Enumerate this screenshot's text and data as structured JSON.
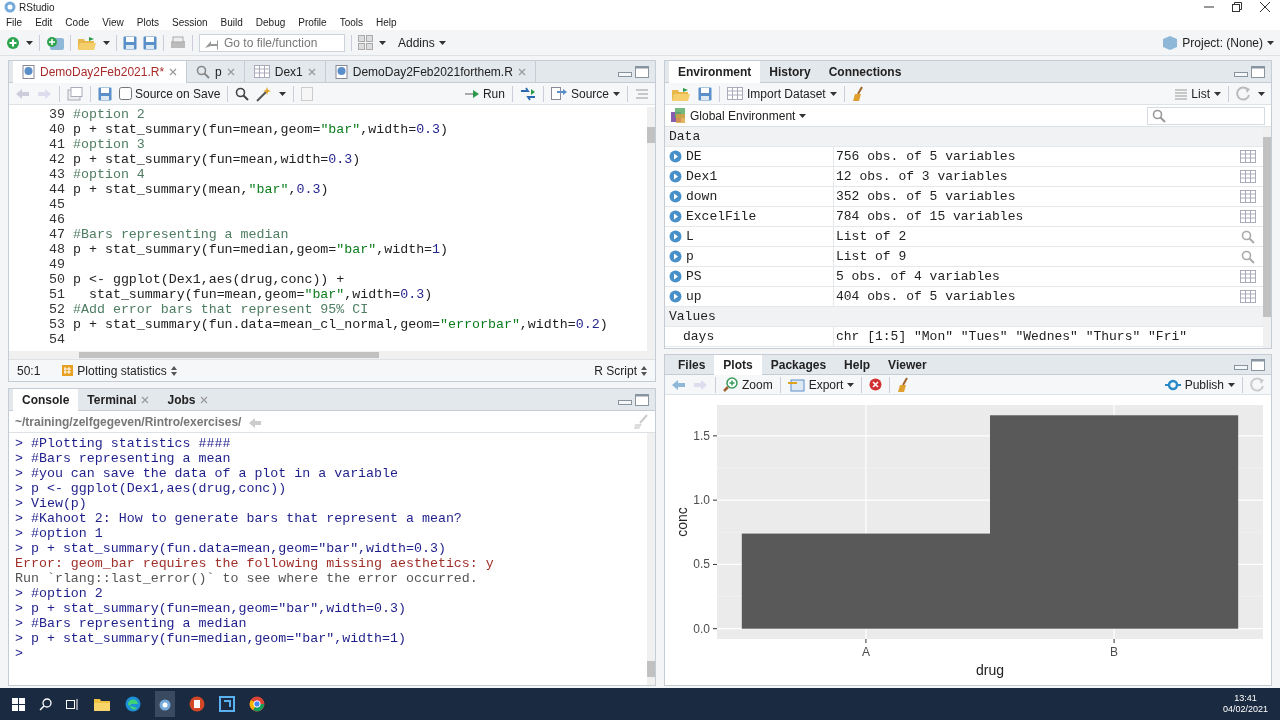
{
  "window": {
    "title": "RStudio"
  },
  "menu": [
    "File",
    "Edit",
    "Code",
    "View",
    "Plots",
    "Session",
    "Build",
    "Debug",
    "Profile",
    "Tools",
    "Help"
  ],
  "toolbar": {
    "goto_placeholder": "Go to file/function",
    "addins": "Addins",
    "project": "Project: (None)"
  },
  "editor": {
    "tabs": [
      {
        "label": "DemoDay2Feb2021.R*",
        "kind": "script",
        "selected": true,
        "unsaved": true
      },
      {
        "label": "p",
        "kind": "search",
        "selected": false,
        "unsaved": false
      },
      {
        "label": "Dex1",
        "kind": "data",
        "selected": false,
        "unsaved": false
      },
      {
        "label": "DemoDay2Feb2021forthem.R",
        "kind": "script",
        "selected": false,
        "unsaved": false
      }
    ],
    "source_on_save": {
      "label": "Source on Save",
      "checked": false
    },
    "run": "Run",
    "source": "Source",
    "lines": [
      {
        "number": "39",
        "code": "#option 2"
      },
      {
        "number": "40",
        "code": "p + stat_summary(fun=mean,geom=\"bar\",width=0.3)"
      },
      {
        "number": "41",
        "code": "#option 3"
      },
      {
        "number": "42",
        "code": "p + stat_summary(fun=mean,width=0.3)"
      },
      {
        "number": "43",
        "code": "#option 4"
      },
      {
        "number": "44",
        "code": "p + stat_summary(mean,\"bar\",0.3)"
      },
      {
        "number": "45"
      },
      {
        "number": "46"
      },
      {
        "number": "47",
        "code": "#Bars representing a median"
      },
      {
        "number": "48",
        "code": "p + stat_summary(fun=median,geom=\"bar\",width=1)"
      },
      {
        "number": "49"
      },
      {
        "number": "50",
        "code": "p <- ggplot(Dex1,aes(drug,conc)) +"
      },
      {
        "number": "51",
        "code": "  stat_summary(fun=mean,geom=\"bar\",width=0.3)"
      },
      {
        "number": "52",
        "code": "#Add error bars that represent 95% CI"
      },
      {
        "number": "53",
        "code": "p + stat_summary(fun.data=mean_cl_normal,geom=\"errorbar\",width=0.2)"
      },
      {
        "number": "54"
      }
    ],
    "status": {
      "position": "50:1",
      "section": "Plotting statistics",
      "filetype": "R Script"
    }
  },
  "console": {
    "tabs": [
      {
        "label": "Console",
        "selected": true,
        "closable": false
      },
      {
        "label": "Terminal",
        "selected": false,
        "closable": true
      },
      {
        "label": "Jobs",
        "selected": false,
        "closable": true
      }
    ],
    "path": "~/training/zelfgegeven/Rintro/exercises/",
    "lines": [
      {
        "kind": "input",
        "text": "> #Plotting statistics ####"
      },
      {
        "kind": "input",
        "text": "> #Bars representing a mean"
      },
      {
        "kind": "input",
        "text": "> #you can save the data of a plot in a variable"
      },
      {
        "kind": "input",
        "text": "> p <- ggplot(Dex1,aes(drug,conc))"
      },
      {
        "kind": "input",
        "text": "> View(p)"
      },
      {
        "kind": "input",
        "text": "> #Kahoot 2: How to generate bars that represent a mean?"
      },
      {
        "kind": "input",
        "text": "> #option 1"
      },
      {
        "kind": "input",
        "text": "> p + stat_summary(fun.data=mean,geom=\"bar\",width=0.3)"
      },
      {
        "kind": "error",
        "text": "Error: geom_bar requires the following missing aesthetics: y"
      },
      {
        "kind": "message",
        "text": "Run `rlang::last_error()` to see where the error occurred."
      },
      {
        "kind": "input",
        "text": "> #option 2"
      },
      {
        "kind": "input",
        "text": "> p + stat_summary(fun=mean,geom=\"bar\",width=0.3)"
      },
      {
        "kind": "input",
        "text": "> #Bars representing a median"
      },
      {
        "kind": "input",
        "text": "> p + stat_summary(fun=median,geom=\"bar\",width=1)"
      },
      {
        "kind": "input",
        "text": ">"
      }
    ]
  },
  "environment": {
    "tabs": [
      {
        "label": "Environment",
        "selected": true
      },
      {
        "label": "History",
        "selected": false
      },
      {
        "label": "Connections",
        "selected": false
      }
    ],
    "import": "Import Dataset",
    "view_mode": "List",
    "scope": "Global Environment",
    "sections": [
      {
        "title": "Data",
        "rows": [
          {
            "name": "DE",
            "value": "756 obs. of 5 variables",
            "kind": "table"
          },
          {
            "name": "Dex1",
            "value": "12 obs. of 3 variables",
            "kind": "table"
          },
          {
            "name": "down",
            "value": "352 obs. of 5 variables",
            "kind": "table"
          },
          {
            "name": "ExcelFile",
            "value": "784 obs. of 15 variables",
            "kind": "table"
          },
          {
            "name": "L",
            "value": "List of 2",
            "kind": "list"
          },
          {
            "name": "p",
            "value": "List of 9",
            "kind": "list"
          },
          {
            "name": "PS",
            "value": "5 obs. of 4 variables",
            "kind": "table"
          },
          {
            "name": "up",
            "value": "404 obs. of 5 variables",
            "kind": "table"
          }
        ]
      },
      {
        "title": "Values",
        "rows": [
          {
            "name": "days",
            "value": "chr [1:5] \"Mon\" \"Tues\" \"Wednes\" \"Thurs\" \"Fri\"",
            "kind": "value"
          }
        ]
      }
    ]
  },
  "plots": {
    "tabs": [
      {
        "label": "Files",
        "selected": false
      },
      {
        "label": "Plots",
        "selected": true
      },
      {
        "label": "Packages",
        "selected": false
      },
      {
        "label": "Help",
        "selected": false
      },
      {
        "label": "Viewer",
        "selected": false
      }
    ],
    "zoom": "Zoom",
    "export": "Export",
    "publish": "Publish",
    "chart_data": {
      "type": "bar",
      "grid": true,
      "xlabel": "drug",
      "ylabel": "conc",
      "categories": [
        "A",
        "B"
      ],
      "values": [
        0.74,
        1.66
      ],
      "ylim": [
        -0.08,
        1.74
      ],
      "yticks": [
        {
          "value": 0,
          "label": "0.0"
        },
        {
          "value": 0.5,
          "label": "0.5"
        },
        {
          "value": 1,
          "label": "1.0"
        },
        {
          "value": 1.5,
          "label": "1.5"
        }
      ]
    }
  },
  "taskbar": {
    "time": "13:41",
    "date": "04/02/2021"
  }
}
